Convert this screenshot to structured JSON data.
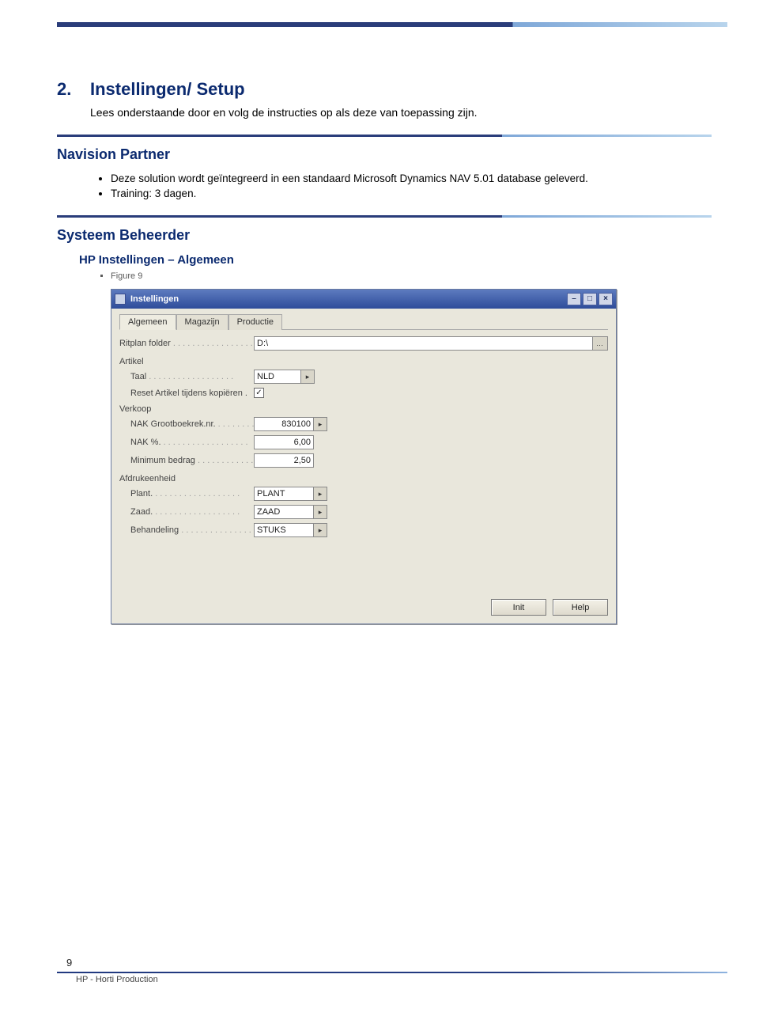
{
  "heading": {
    "number": "2.",
    "title": "Instellingen/ Setup",
    "intro": "Lees onderstaande door en volg de instructies op als deze van toepassing zijn."
  },
  "partner": {
    "title": "Navision Partner",
    "bullets": [
      "Deze solution wordt geïntegreerd in een standaard Microsoft Dynamics NAV 5.01 database geleverd.",
      "Training: 3 dagen."
    ]
  },
  "beheerder": {
    "title": "Systeem Beheerder",
    "sub": "HP Instellingen – Algemeen",
    "figure": "Figure 9"
  },
  "dialog": {
    "title": "Instellingen",
    "tabs": [
      "Algemeen",
      "Magazijn",
      "Productie"
    ],
    "active_tab": 0,
    "ritplan": {
      "label": "Ritplan folder",
      "value": "D:\\"
    },
    "artikel": {
      "section": "Artikel",
      "taal": {
        "label": "Taal",
        "value": "NLD"
      },
      "reset": {
        "label": "Reset Artikel tijdens kopiëren .",
        "checked": true
      }
    },
    "verkoop": {
      "section": "Verkoop",
      "nak_gb": {
        "label": "NAK Grootboekrek.nr.",
        "value": "830100"
      },
      "nak_pct": {
        "label": "NAK %.",
        "value": "6,00"
      },
      "min_bedrag": {
        "label": "Minimum bedrag",
        "value": "2,50"
      }
    },
    "afdruk": {
      "section": "Afdrukeenheid",
      "plant": {
        "label": "Plant.",
        "value": "PLANT"
      },
      "zaad": {
        "label": "Zaad.",
        "value": "ZAAD"
      },
      "behandeling": {
        "label": "Behandeling",
        "value": "STUKS"
      }
    },
    "buttons": {
      "init": "Init",
      "help": "Help"
    }
  },
  "footer": {
    "page": "9",
    "doc": "HP - Horti Production"
  }
}
